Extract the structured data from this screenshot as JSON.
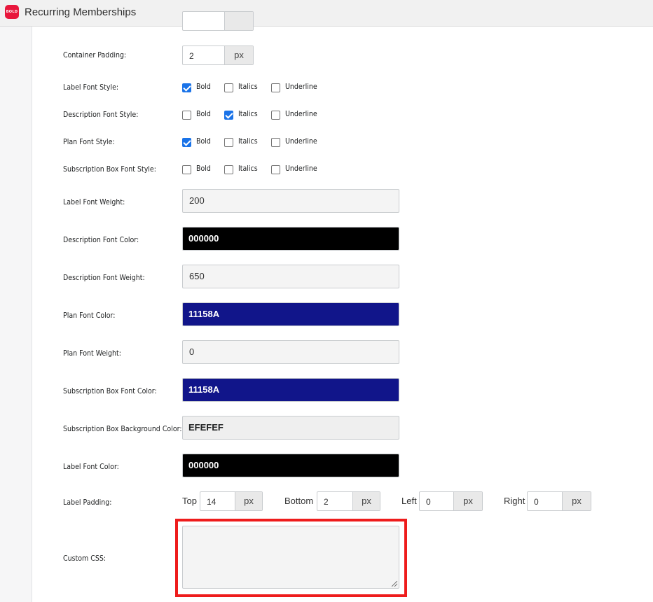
{
  "app": {
    "title": "Recurring Memberships",
    "logo_text": "BOLD"
  },
  "form": {
    "container_padding": {
      "label": "Container Padding:",
      "value": "2",
      "unit": "px"
    },
    "font_style_options": {
      "bold": "Bold",
      "italics": "Italics",
      "underline": "Underline"
    },
    "label_font_style": {
      "label": "Label Font Style:",
      "bold": true,
      "italics": false,
      "underline": false
    },
    "description_font_style": {
      "label": "Description Font Style:",
      "bold": false,
      "italics": true,
      "underline": false
    },
    "plan_font_style": {
      "label": "Plan Font Style:",
      "bold": true,
      "italics": false,
      "underline": false
    },
    "subscription_box_font_style": {
      "label": "Subscription Box Font Style:",
      "bold": false,
      "italics": false,
      "underline": false
    },
    "label_font_weight": {
      "label": "Label Font Weight:",
      "value": "200"
    },
    "description_font_color": {
      "label": "Description Font Color:",
      "value": "000000",
      "color": "#000000"
    },
    "description_font_weight": {
      "label": "Description Font Weight:",
      "value": "650"
    },
    "plan_font_color": {
      "label": "Plan Font Color:",
      "value": "11158A",
      "color": "#11158A"
    },
    "plan_font_weight": {
      "label": "Plan Font Weight:",
      "value": "0"
    },
    "subscription_box_font_color": {
      "label": "Subscription Box Font Color:",
      "value": "11158A",
      "color": "#11158A"
    },
    "subscription_box_background_color": {
      "label": "Subscription Box Background Color:",
      "value": "EFEFEF",
      "color": "#EFEFEF"
    },
    "label_font_color": {
      "label": "Label Font Color:",
      "value": "000000",
      "color": "#000000"
    },
    "label_padding": {
      "label": "Label Padding:",
      "unit": "px",
      "top": {
        "label": "Top",
        "value": "14"
      },
      "bottom": {
        "label": "Bottom",
        "value": "2"
      },
      "left": {
        "label": "Left",
        "value": "0"
      },
      "right": {
        "label": "Right",
        "value": "0"
      }
    },
    "custom_css": {
      "label": "Custom CSS:",
      "value": ""
    }
  },
  "colors": {
    "highlight": "#ee1c1c",
    "checkbox_checked": "#1a73e8",
    "brand": "#e8173c"
  }
}
